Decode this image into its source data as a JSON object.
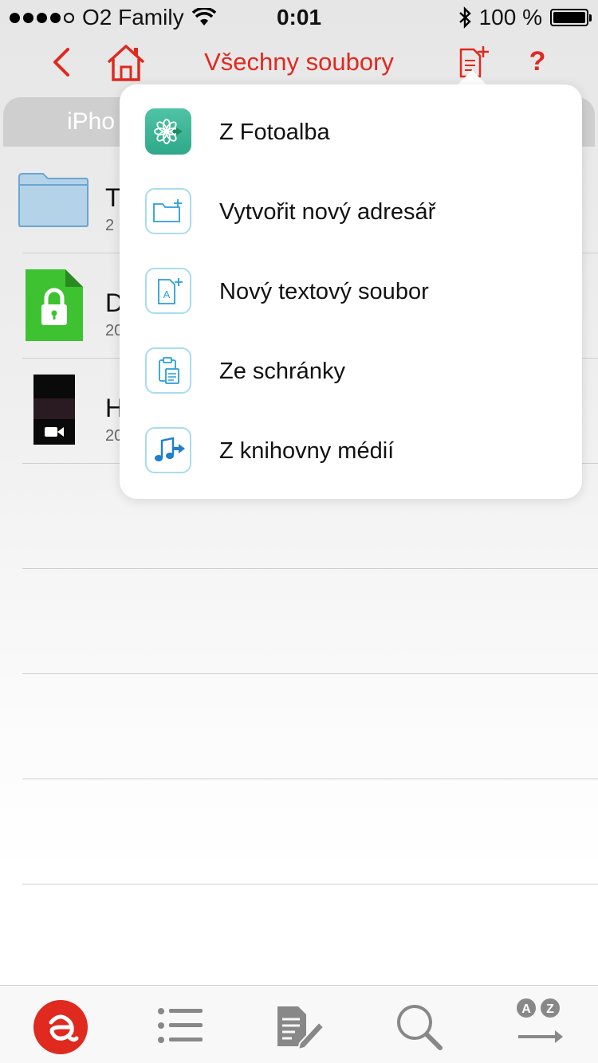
{
  "status_bar": {
    "carrier": "O2 Family",
    "time": "0:01",
    "battery": "100 %",
    "battery_level": 1.0,
    "signal_bars": 4
  },
  "nav": {
    "title": "Všechny soubory",
    "help": "?",
    "accent_color": "#e0291f"
  },
  "tabs": {
    "iphone_label": "iPho"
  },
  "files": [
    {
      "name": "T",
      "meta": "2",
      "icon": "folder-icon"
    },
    {
      "name": "D",
      "meta": "20",
      "icon": "locked-file-icon"
    },
    {
      "name": "H",
      "meta": "20",
      "icon": "video-thumbnail-icon"
    }
  ],
  "popup_menu": {
    "items": [
      {
        "label": "Z Fotoalba",
        "icon": "photo-album-icon"
      },
      {
        "label": "Vytvořit nový adresář",
        "icon": "new-folder-icon"
      },
      {
        "label": "Nový textový soubor",
        "icon": "new-text-file-icon"
      },
      {
        "label": "Ze schránky",
        "icon": "clipboard-icon"
      },
      {
        "label": "Z knihovny médií",
        "icon": "media-library-icon"
      }
    ]
  },
  "tab_bar": {
    "items": [
      "app-logo-icon",
      "list-icon",
      "notes-icon",
      "search-icon",
      "sort-az-icon"
    ]
  }
}
